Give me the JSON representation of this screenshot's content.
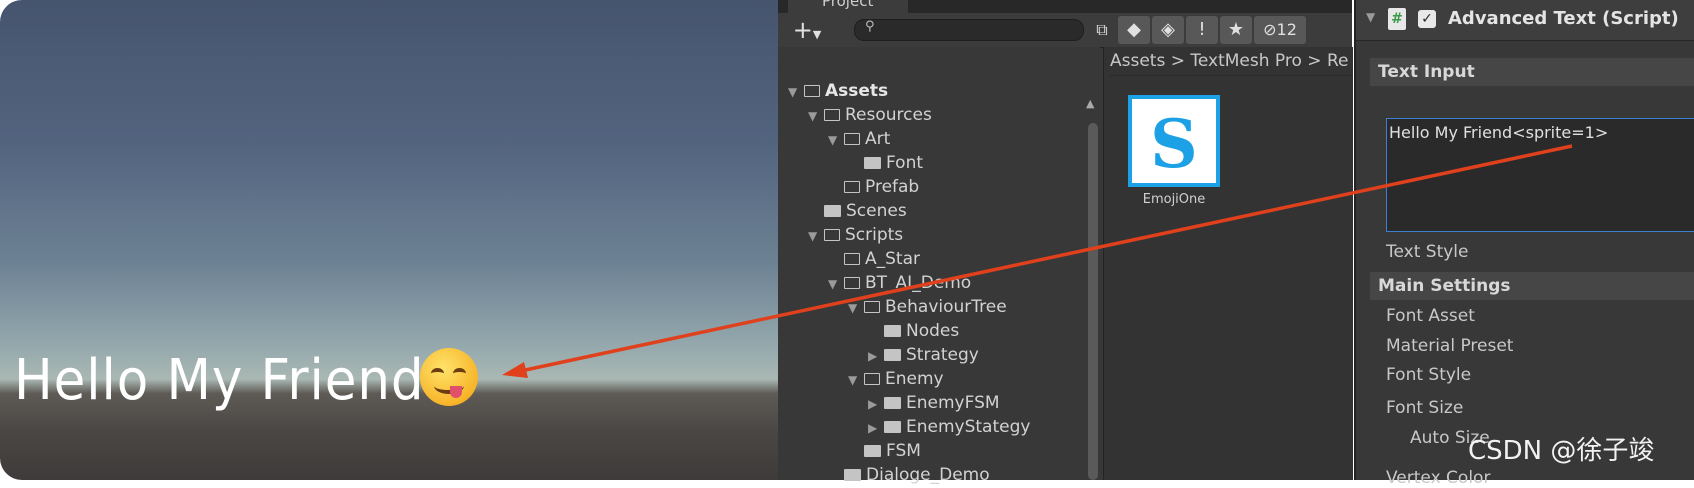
{
  "scene": {
    "text": "Hello My Friend"
  },
  "project": {
    "tab_label": "Project",
    "toolbar": {
      "add_label": "+",
      "search_icon": "⚲",
      "hidden_count": "12"
    },
    "tree": [
      {
        "label": "Assets",
        "depth": 0,
        "expand": "open",
        "icon": "open",
        "bold": true
      },
      {
        "label": "Resources",
        "depth": 1,
        "expand": "open",
        "icon": "open"
      },
      {
        "label": "Art",
        "depth": 2,
        "expand": "open",
        "icon": "open"
      },
      {
        "label": "Font",
        "depth": 3,
        "expand": "none",
        "icon": "closed"
      },
      {
        "label": "Prefab",
        "depth": 2,
        "expand": "none",
        "icon": "empty"
      },
      {
        "label": "Scenes",
        "depth": 1,
        "expand": "none",
        "icon": "closed"
      },
      {
        "label": "Scripts",
        "depth": 1,
        "expand": "open",
        "icon": "open"
      },
      {
        "label": "A_Star",
        "depth": 2,
        "expand": "none",
        "icon": "empty"
      },
      {
        "label": "BT_AI_Demo",
        "depth": 2,
        "expand": "open",
        "icon": "open"
      },
      {
        "label": "BehaviourTree",
        "depth": 3,
        "expand": "open",
        "icon": "open"
      },
      {
        "label": "Nodes",
        "depth": 4,
        "expand": "none",
        "icon": "closed"
      },
      {
        "label": "Strategy",
        "depth": 4,
        "expand": "closed",
        "icon": "closed"
      },
      {
        "label": "Enemy",
        "depth": 3,
        "expand": "open",
        "icon": "open"
      },
      {
        "label": "EnemyFSM",
        "depth": 4,
        "expand": "closed",
        "icon": "closed"
      },
      {
        "label": "EnemyStategy",
        "depth": 4,
        "expand": "closed",
        "icon": "closed"
      },
      {
        "label": "FSM",
        "depth": 3,
        "expand": "none",
        "icon": "closed"
      },
      {
        "label": "Dialoge_Demo",
        "depth": 2,
        "expand": "none",
        "icon": "closed"
      }
    ],
    "breadcrumb": "Assets  >  TextMesh Pro  >  Re",
    "asset": {
      "glyph": "S",
      "label": "EmojiOne"
    }
  },
  "inspector": {
    "component_title": "Advanced Text (Script)",
    "text_input_header": "Text Input",
    "text_value": "Hello My Friend<sprite=1>",
    "text_style_label": "Text Style",
    "main_settings_header": "Main Settings",
    "props": {
      "font_asset": "Font Asset",
      "material_preset": "Material Preset",
      "font_style": "Font Style",
      "font_size": "Font Size",
      "auto_size": "Auto Size",
      "vertex_color": "Vertex Color"
    }
  },
  "watermark": "CSDN @徐子竣",
  "colors": {
    "accent": "#3d7fd1",
    "arrow": "#e0401c",
    "emoji_blue": "#1da1e6"
  }
}
